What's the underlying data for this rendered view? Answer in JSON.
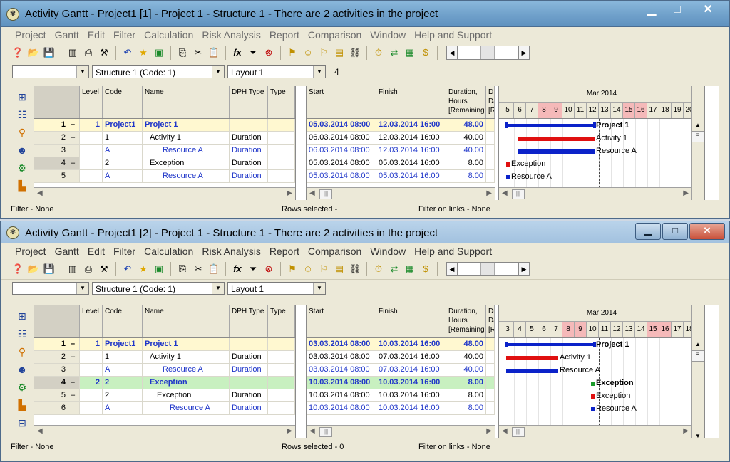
{
  "colors": {
    "project_bar": "#0b22c9",
    "activity_bar": "#e01010",
    "weekend": "#f5b9b9",
    "exception_row": "#c8f0c0",
    "project_row": "#fff8d0"
  },
  "windows": [
    {
      "title": "Activity Gantt - Project1 [1] - Project 1 - Structure 1 - There are 2 activities in the project",
      "menu": [
        "Project",
        "Gantt",
        "Edit",
        "Filter",
        "Calculation",
        "Risk Analysis",
        "Report",
        "Comparison",
        "Window",
        "Help and Support"
      ],
      "combo_filter": "",
      "combo_structure": "Structure 1  (Code: 1)",
      "combo_layout": "Layout  1",
      "combo_count": "4",
      "columns": {
        "level": "Level",
        "code": "Code",
        "name": "Name",
        "dph_type": "DPH Type",
        "type": "Type",
        "start": "Start",
        "finish": "Finish",
        "duration": "Duration, Hours [Remaining",
        "extra": "D Da [R"
      },
      "month": "Mar 2014",
      "days": [
        "5",
        "6",
        "7",
        "8",
        "9",
        "10",
        "11",
        "12",
        "13",
        "14",
        "15",
        "16",
        "17",
        "18",
        "19",
        "20",
        "2"
      ],
      "rows": [
        {
          "num": "1",
          "dash": "–",
          "level": "1",
          "code": "Project1",
          "name": "Project 1",
          "dph": "",
          "start": "05.03.2014  08:00",
          "finish": "12.03.2014  16:00",
          "duration": "48.00",
          "label": "Project 1"
        },
        {
          "num": "2",
          "dash": "–",
          "level": "",
          "code": "1",
          "name": "Activity 1",
          "dph": "Duration",
          "start": "06.03.2014  08:00",
          "finish": "12.03.2014  16:00",
          "duration": "40.00",
          "label": "Activity 1"
        },
        {
          "num": "3",
          "dash": "",
          "level": "",
          "code": "A",
          "name": "Resource  A",
          "dph": "Duration",
          "start": "06.03.2014  08:00",
          "finish": "12.03.2014  16:00",
          "duration": "40.00",
          "label": "Resource  A"
        },
        {
          "num": "4",
          "dash": "–",
          "level": "",
          "code": "2",
          "name": "Exception",
          "dph": "Duration",
          "start": "05.03.2014  08:00",
          "finish": "05.03.2014  16:00",
          "duration": "8.00",
          "label": "Exception"
        },
        {
          "num": "5",
          "dash": "",
          "level": "",
          "code": "A",
          "name": "Resource  A",
          "dph": "Duration",
          "start": "05.03.2014  08:00",
          "finish": "05.03.2014  16:00",
          "duration": "8.00",
          "label": "Resource  A"
        }
      ],
      "status": {
        "filter": "Filter  -  None",
        "rows": "Rows selected  -",
        "links": "Filter on links  -  None"
      }
    },
    {
      "title": "Activity Gantt - Project1 [2] - Project 1 - Structure 1 - There are 2 activities in the project",
      "menu": [
        "Project",
        "Gantt",
        "Edit",
        "Filter",
        "Calculation",
        "Risk Analysis",
        "Report",
        "Comparison",
        "Window",
        "Help and Support"
      ],
      "combo_filter": "",
      "combo_structure": "Structure 1  (Code: 1)",
      "combo_layout": "Layout  1",
      "columns": {
        "level": "Level",
        "code": "Code",
        "name": "Name",
        "dph_type": "DPH Type",
        "type": "Type",
        "start": "Start",
        "finish": "Finish",
        "duration": "Duration, Hours [Remaining",
        "extra": "Du Da [Re"
      },
      "month": "Mar 2014",
      "days": [
        "3",
        "4",
        "5",
        "6",
        "7",
        "8",
        "9",
        "10",
        "11",
        "12",
        "13",
        "14",
        "15",
        "16",
        "17",
        "18",
        "19"
      ],
      "rows": [
        {
          "num": "1",
          "dash": "–",
          "level": "1",
          "code": "Project1",
          "name": "Project 1",
          "dph": "",
          "start": "03.03.2014  08:00",
          "finish": "10.03.2014  16:00",
          "duration": "48.00",
          "label": "Project 1"
        },
        {
          "num": "2",
          "dash": "–",
          "level": "",
          "code": "1",
          "name": "Activity 1",
          "dph": "Duration",
          "start": "03.03.2014  08:00",
          "finish": "07.03.2014  16:00",
          "duration": "40.00",
          "label": "Activity 1"
        },
        {
          "num": "3",
          "dash": "",
          "level": "",
          "code": "A",
          "name": "Resource  A",
          "dph": "Duration",
          "start": "03.03.2014  08:00",
          "finish": "07.03.2014  16:00",
          "duration": "40.00",
          "label": "Resource  A"
        },
        {
          "num": "4",
          "dash": "–",
          "level": "2",
          "code": "2",
          "name": "Exception",
          "dph": "",
          "start": "10.03.2014  08:00",
          "finish": "10.03.2014  16:00",
          "duration": "8.00",
          "label": "Exception"
        },
        {
          "num": "5",
          "dash": "–",
          "level": "",
          "code": "2",
          "name": "Exception",
          "dph": "Duration",
          "start": "10.03.2014  08:00",
          "finish": "10.03.2014  16:00",
          "duration": "8.00",
          "label": "Exception"
        },
        {
          "num": "6",
          "dash": "",
          "level": "",
          "code": "A",
          "name": "Resource  A",
          "dph": "Duration",
          "start": "10.03.2014  08:00",
          "finish": "10.03.2014  16:00",
          "duration": "8.00",
          "label": "Resource  A"
        }
      ],
      "status": {
        "filter": "Filter  -  None",
        "rows": "Rows selected  -  0",
        "links": "Filter on links  -  None"
      }
    }
  ]
}
